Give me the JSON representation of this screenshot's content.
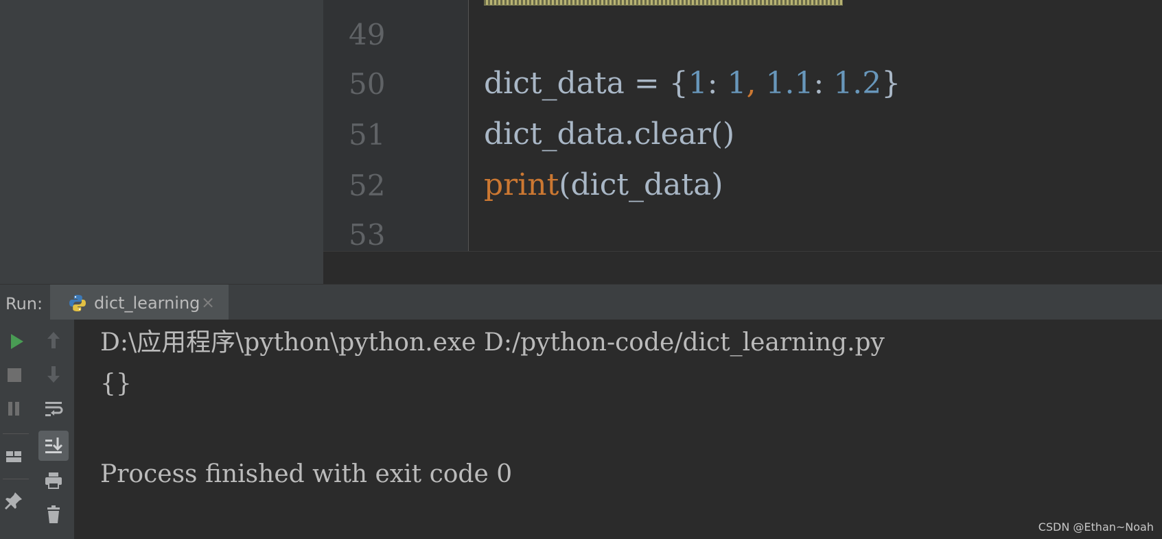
{
  "editor": {
    "lines": [
      {
        "number": "49",
        "code": ""
      },
      {
        "number": "50",
        "code": "dict_data = {1: 1, 1.1: 1.2}"
      },
      {
        "number": "51",
        "code": "dict_data.clear()"
      },
      {
        "number": "52",
        "code": "print(dict_data)"
      },
      {
        "number": "53",
        "code": ""
      }
    ],
    "line50": {
      "var": "dict_data",
      "eq": " = ",
      "open": "{",
      "k1": "1",
      "colon1": ": ",
      "v1": "1",
      "comma": ", ",
      "k2": "1.1",
      "colon2": ": ",
      "v2": "1.2",
      "close": "}"
    },
    "line52": {
      "func": "print",
      "args": "(dict_data)"
    }
  },
  "run": {
    "label": "Run:",
    "tab_label": "dict_learning",
    "tab_close": "×",
    "output": [
      "D:\\应用程序\\python\\python.exe D:/python-code/dict_learning.py",
      "{}",
      "",
      "Process finished with exit code 0"
    ]
  },
  "toolbar": {
    "left": [
      "run-icon",
      "stop-icon",
      "pause-icon",
      "layout-icon",
      "pin-icon"
    ],
    "right": [
      "up-arrow-icon",
      "down-arrow-icon",
      "soft-wrap-icon",
      "scroll-to-end-icon",
      "print-icon",
      "trash-icon"
    ]
  },
  "colors": {
    "number": "#6897bb",
    "keyword": "#cc7832",
    "text": "#a9b7c6",
    "run_green": "#499c54"
  },
  "watermark": "CSDN @Ethan~Noah"
}
